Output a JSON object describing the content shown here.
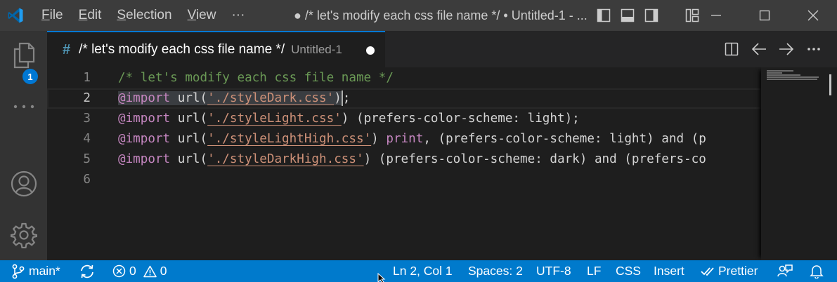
{
  "titlebar": {
    "menu": [
      {
        "pre": "",
        "u": "F",
        "post": "ile"
      },
      {
        "pre": "",
        "u": "E",
        "post": "dit"
      },
      {
        "pre": "",
        "u": "S",
        "post": "election"
      },
      {
        "pre": "",
        "u": "V",
        "post": "iew"
      },
      {
        "pre": "",
        "u": "",
        "post": "···"
      }
    ],
    "window_title": "● /* let's modify each css file name */ • Untitled-1 - ..."
  },
  "activity": {
    "explorer_badge": "1"
  },
  "tab": {
    "file_icon": "#",
    "title": "/* let's modify each css file name */",
    "description": "Untitled-1"
  },
  "editor": {
    "lines": [
      {
        "num": "1",
        "tokens": [
          {
            "t": "/* let's modify each css file name */",
            "c": "comment"
          }
        ]
      },
      {
        "num": "2",
        "tokens": [
          {
            "t": "@import",
            "c": "kw"
          },
          {
            "t": " url(",
            "c": "plain"
          },
          {
            "t": "'./styleDark.css'",
            "c": "str"
          },
          {
            "t": ")",
            "c": "plain"
          },
          {
            "t": ";",
            "c": "plain"
          }
        ]
      },
      {
        "num": "3",
        "tokens": [
          {
            "t": "@import",
            "c": "kw"
          },
          {
            "t": " url(",
            "c": "plain"
          },
          {
            "t": "'./styleLight.css'",
            "c": "str"
          },
          {
            "t": ") (prefers-color-scheme: light);",
            "c": "plain"
          }
        ]
      },
      {
        "num": "4",
        "tokens": [
          {
            "t": "@import",
            "c": "kw"
          },
          {
            "t": " url(",
            "c": "plain"
          },
          {
            "t": "'./styleLightHigh.css'",
            "c": "str"
          },
          {
            "t": ") ",
            "c": "plain"
          },
          {
            "t": "print",
            "c": "kw"
          },
          {
            "t": ", (prefers-color-scheme: light) and (p",
            "c": "plain"
          }
        ]
      },
      {
        "num": "5",
        "tokens": [
          {
            "t": "@import",
            "c": "kw"
          },
          {
            "t": " url(",
            "c": "plain"
          },
          {
            "t": "'./styleDarkHigh.css'",
            "c": "str"
          },
          {
            "t": ") (prefers-color-scheme: dark) and (prefers-co",
            "c": "plain"
          }
        ]
      },
      {
        "num": "6",
        "tokens": []
      }
    ],
    "current_line": "2"
  },
  "statusbar": {
    "branch": "main*",
    "errors": "0",
    "warnings": "0",
    "position": "Ln 2, Col 1",
    "spaces": "Spaces: 2",
    "encoding": "UTF-8",
    "eol": "LF",
    "language": "CSS",
    "mode": "Insert",
    "formatter": "Prettier"
  },
  "colors": {
    "accent": "#007acc",
    "comment": "#6a9955",
    "keyword": "#c586c0",
    "string": "#ce9178",
    "text": "#d4d4d4"
  },
  "icons": [
    "vscode-logo-icon",
    "primary-sidebar-toggle-icon",
    "panel-toggle-icon",
    "secondary-sidebar-toggle-icon",
    "customize-layout-icon",
    "minimize-icon",
    "maximize-icon",
    "close-icon",
    "files-icon",
    "more-icon",
    "account-icon",
    "gear-icon",
    "split-editor-icon",
    "arrow-left-icon",
    "arrow-right-icon",
    "ellipsis-icon",
    "branch-icon",
    "sync-icon",
    "error-icon",
    "warning-icon",
    "check-all-icon",
    "feedback-icon",
    "bell-icon"
  ]
}
